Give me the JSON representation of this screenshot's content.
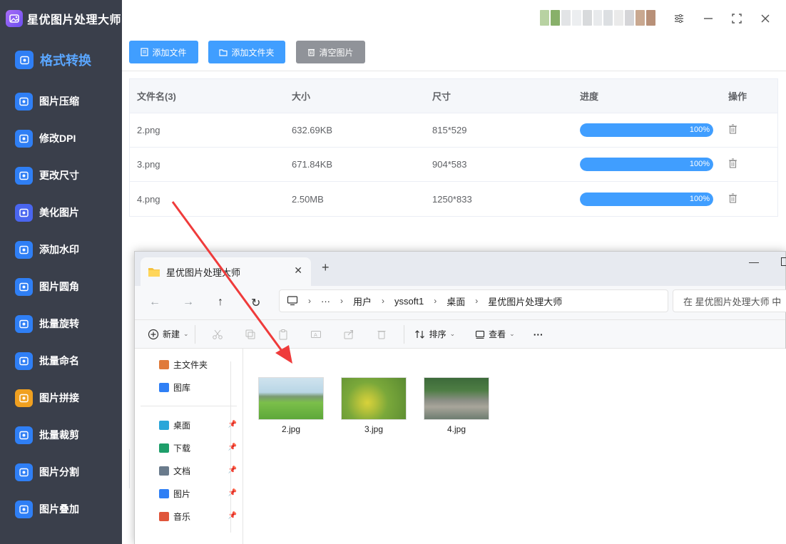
{
  "app": {
    "title": "星优图片处理大师",
    "brand_color": "#7b57f5",
    "accent_color": "#409eff",
    "sidebar_bg": "#3a3f4b"
  },
  "sidebar": {
    "items": [
      {
        "label": "格式转换",
        "icon": "format-convert-icon",
        "active": true
      },
      {
        "label": "图片压缩",
        "icon": "image-compress-icon"
      },
      {
        "label": "修改DPI",
        "icon": "dpi-icon"
      },
      {
        "label": "更改尺寸",
        "icon": "resize-icon"
      },
      {
        "label": "美化图片",
        "icon": "beautify-icon"
      },
      {
        "label": "添加水印",
        "icon": "watermark-icon"
      },
      {
        "label": "图片圆角",
        "icon": "rounded-corner-icon"
      },
      {
        "label": "批量旋转",
        "icon": "rotate-icon"
      },
      {
        "label": "批量命名",
        "icon": "rename-icon"
      },
      {
        "label": "图片拼接",
        "icon": "stitch-icon"
      },
      {
        "label": "批量裁剪",
        "icon": "crop-icon"
      },
      {
        "label": "图片分割",
        "icon": "split-icon"
      },
      {
        "label": "图片叠加",
        "icon": "overlay-icon"
      }
    ]
  },
  "titlebar": {
    "controls": [
      "settings-icon",
      "minimize-icon",
      "maximize-icon",
      "close-icon"
    ]
  },
  "toolbar": {
    "add_file": "添加文件",
    "add_folder": "添加文件夹",
    "clear": "清空图片"
  },
  "table": {
    "headers": [
      "文件名(3)",
      "大小",
      "尺寸",
      "进度",
      "操作"
    ],
    "rows": [
      {
        "name": "2.png",
        "size": "632.69KB",
        "dims": "815*529",
        "progress": 100,
        "progress_label": "100%"
      },
      {
        "name": "3.png",
        "size": "671.84KB",
        "dims": "904*583",
        "progress": 100,
        "progress_label": "100%"
      },
      {
        "name": "4.png",
        "size": "2.50MB",
        "dims": "1250*833",
        "progress": 100,
        "progress_label": "100%"
      }
    ]
  },
  "explorer": {
    "tab_title": "星优图片处理大师",
    "new_tab": "+",
    "breadcrumb": [
      "用户",
      "yssoft1",
      "桌面",
      "星优图片处理大师"
    ],
    "breadcrumb_more": "···",
    "search_placeholder": "在 星优图片处理大师 中",
    "commands": {
      "new": "新建",
      "sort": "排序",
      "view": "查看",
      "more": "···"
    },
    "sidebar": [
      {
        "label": "主文件夹",
        "icon": "home-icon"
      },
      {
        "label": "图库",
        "icon": "gallery-icon"
      }
    ],
    "quick_access": [
      {
        "label": "桌面",
        "icon": "desktop-icon"
      },
      {
        "label": "下载",
        "icon": "download-icon"
      },
      {
        "label": "文档",
        "icon": "document-icon"
      },
      {
        "label": "图片",
        "icon": "pictures-icon"
      },
      {
        "label": "音乐",
        "icon": "music-icon"
      }
    ],
    "files": [
      {
        "name": "2.jpg"
      },
      {
        "name": "3.jpg"
      },
      {
        "name": "4.jpg"
      }
    ]
  }
}
